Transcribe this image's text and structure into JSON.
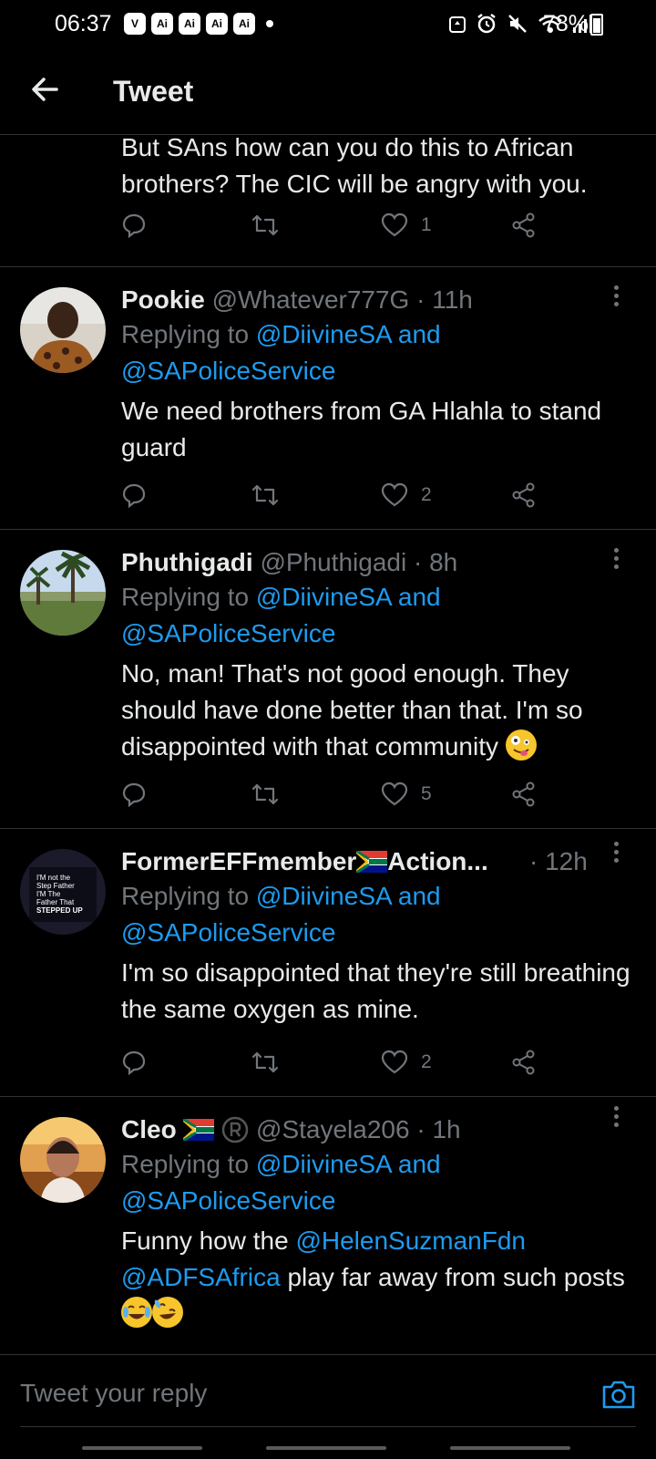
{
  "status_bar": {
    "time": "06:37",
    "notif_icons": [
      "V",
      "Ai",
      "Ai",
      "Ai",
      "Ai"
    ],
    "battery": "78%"
  },
  "header": {
    "title": "Tweet"
  },
  "partial_tweet": {
    "text": "But SAns how can you do this to  African brothers? The CIC will be angry with you.",
    "likes": "1"
  },
  "tweets": [
    {
      "name": "Pookie",
      "handle": "@Whatever777G",
      "time": "· 11h",
      "replying_prefix": "Replying to ",
      "replying_to": "@DiivineSA and",
      "replying_to2": "@SAPoliceService",
      "text": "We need brothers from GA Hlahla to stand guard",
      "likes": "2"
    },
    {
      "name": "Phuthigadi",
      "handle": "@Phuthigadi",
      "time": "· 8h",
      "replying_prefix": "Replying to ",
      "replying_to": "@DiivineSA and",
      "replying_to2": "@SAPoliceService",
      "text": "No, man! That's not good enough. They should have done better than that. I'm so disappointed with that community",
      "likes": "5"
    },
    {
      "name": "FormerEFFmember",
      "name_suffix": "Action...",
      "handle": "",
      "time": "· 12h",
      "replying_prefix": "Replying to ",
      "replying_to": "@DiivineSA and",
      "replying_to2": "@SAPoliceService",
      "text": "I'm so disappointed that they're still breathing the same oxygen as mine.",
      "likes": "2",
      "avatar_text": "I'M not the Step Father I'M The Father That STEPPED UP"
    },
    {
      "name": "Cleo",
      "handle": "@Stayela206",
      "time": "· 1h",
      "replying_prefix": "Replying to ",
      "replying_to": "@DiivineSA and",
      "replying_to2": "@SAPoliceService",
      "text_pre": "Funny how the ",
      "mention1": "@HelenSuzmanFdn",
      "mention2": "@ADFSAfrica",
      "text_post": " play far away from such posts"
    }
  ],
  "reply_bar": {
    "placeholder": "Tweet your reply"
  },
  "colors": {
    "link": "#1d9bf0",
    "muted": "#71767b",
    "text": "#e7e9ea",
    "background": "#000000",
    "divider": "#2f3336"
  }
}
